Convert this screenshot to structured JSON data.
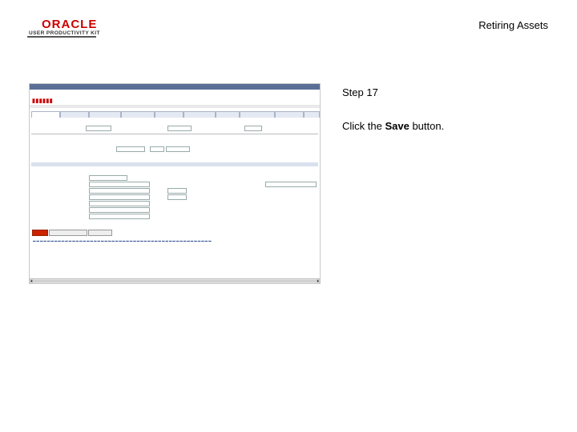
{
  "header": {
    "logo_word": "ORACLE",
    "logo_sub": "USER PRODUCTIVITY KIT",
    "page_title": "Retiring Assets",
    "brand_color": "#cc0000"
  },
  "instructions": {
    "step": "Step 17",
    "text_before": "Click the ",
    "text_bold": "Save",
    "text_after": " button."
  }
}
